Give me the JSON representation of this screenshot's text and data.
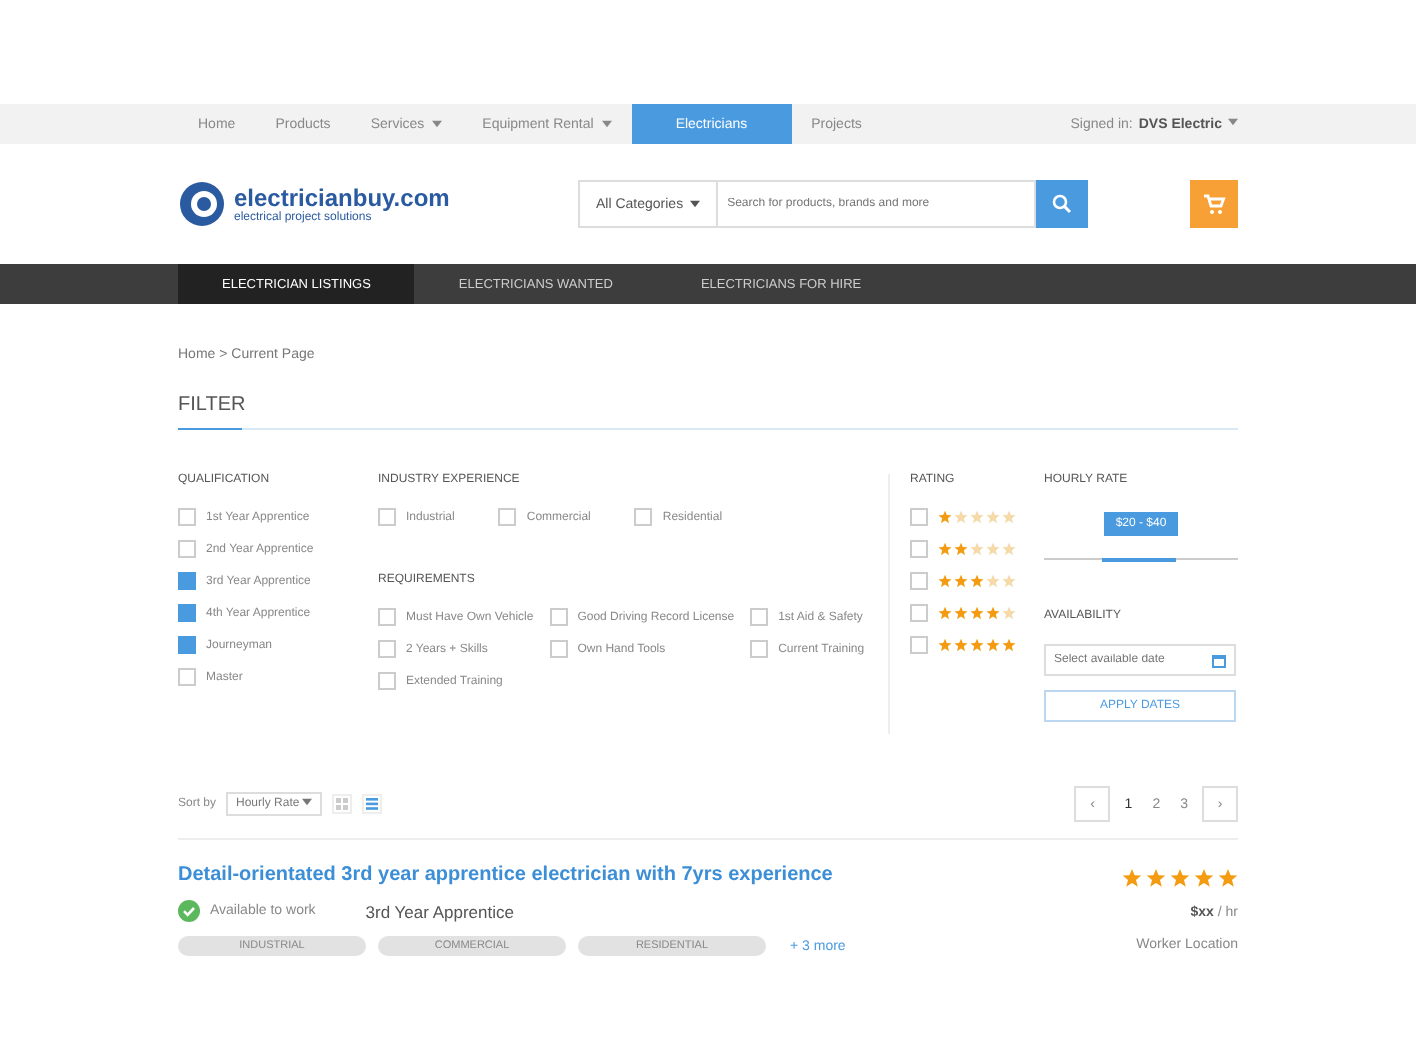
{
  "top_nav": {
    "items": [
      {
        "label": "Home",
        "dropdown": false,
        "selected": false
      },
      {
        "label": "Products",
        "dropdown": false,
        "selected": false
      },
      {
        "label": "Services",
        "dropdown": true,
        "selected": false
      },
      {
        "label": "Equipment Rental",
        "dropdown": true,
        "selected": false
      },
      {
        "label": "Electricians",
        "dropdown": false,
        "selected": true
      },
      {
        "label": "Projects",
        "dropdown": false,
        "selected": false
      }
    ],
    "account_prefix": "Signed in:",
    "account_name": "DVS Electric"
  },
  "header": {
    "logo_name": "electricianbuy.com",
    "logo_tagline": "electrical project solutions",
    "category": "All Categories",
    "search_placeholder": "Search for products, brands and more"
  },
  "sub_nav": [
    {
      "label": "ELECTRICIAN LISTINGS",
      "selected": true
    },
    {
      "label": "ELECTRICIANS WANTED",
      "selected": false
    },
    {
      "label": "ELECTRICIANS FOR HIRE",
      "selected": false
    }
  ],
  "breadcrumb": "Home > Current Page",
  "filter": {
    "title": "FILTER",
    "qualification": {
      "title": "QUALIFICATION",
      "options": [
        {
          "label": "1st Year Apprentice",
          "checked": false
        },
        {
          "label": "2nd Year Apprentice",
          "checked": false
        },
        {
          "label": "3rd Year Apprentice",
          "checked": true
        },
        {
          "label": "4th Year Apprentice",
          "checked": true
        },
        {
          "label": "Journeyman",
          "checked": true
        },
        {
          "label": "Master",
          "checked": false
        }
      ]
    },
    "industry": {
      "title": "INDUSTRY EXPERIENCE",
      "options": [
        {
          "label": "Industrial",
          "checked": false
        },
        {
          "label": "Commercial",
          "checked": false
        },
        {
          "label": "Residential",
          "checked": false
        }
      ]
    },
    "requirements": {
      "title": "REQUIREMENTS",
      "options": [
        {
          "label": "Must Have Own Vehicle",
          "checked": false
        },
        {
          "label": "Good Driving Record License",
          "checked": false
        },
        {
          "label": "1st Aid & Safety",
          "checked": false
        },
        {
          "label": "2 Years + Skills",
          "checked": false
        },
        {
          "label": "Own Hand Tools",
          "checked": false
        },
        {
          "label": "Current Training",
          "checked": false
        },
        {
          "label": "Extended Training",
          "checked": false
        }
      ]
    },
    "rating": {
      "title": "RATING",
      "options": [
        {
          "stars": 1,
          "checked": false
        },
        {
          "stars": 2,
          "checked": false
        },
        {
          "stars": 3,
          "checked": false
        },
        {
          "stars": 4,
          "checked": false
        },
        {
          "stars": 5,
          "checked": false
        }
      ]
    },
    "hourly_rate": {
      "title": "HOURLY RATE",
      "tooltip": "$20 - $40"
    },
    "availability": {
      "title": "AVAILABILITY",
      "placeholder": "Select available date",
      "button": "APPLY DATES"
    }
  },
  "toolbar": {
    "sort_label": "Sort by",
    "sort_value": "Hourly Rate",
    "view": [
      {
        "kind": "grid",
        "selected": false
      },
      {
        "kind": "list",
        "selected": true
      }
    ],
    "pages": [
      {
        "label": "‹",
        "kind": "arrow",
        "selected": false
      },
      {
        "label": "1",
        "kind": "page",
        "selected": true
      },
      {
        "label": "2",
        "kind": "page",
        "selected": false
      },
      {
        "label": "3",
        "kind": "page",
        "selected": false
      },
      {
        "label": "›",
        "kind": "arrow",
        "selected": false
      }
    ]
  },
  "listing": {
    "title": "Detail-orientated 3rd year apprentice electrician with 7yrs experience",
    "status": "Available to work",
    "level": "3rd Year Apprentice",
    "tags": [
      "INDUSTRIAL",
      "COMMERCIAL",
      "RESIDENTIAL"
    ],
    "more": "+ 3 more",
    "stars": 5,
    "rate": "$xx",
    "rate_unit": "/ hr",
    "location": "Worker Location"
  }
}
